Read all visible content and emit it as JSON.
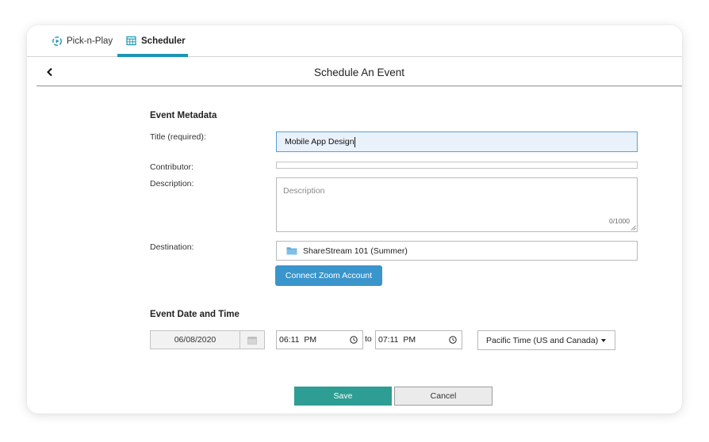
{
  "tabs": [
    {
      "label": "Pick-n-Play",
      "icon": "pick-n-play-icon",
      "active": false
    },
    {
      "label": "Scheduler",
      "icon": "calendar-grid-icon",
      "active": true
    }
  ],
  "header": {
    "title": "Schedule An Event",
    "back_icon": "chevron-left-icon"
  },
  "metadata": {
    "section_title": "Event Metadata",
    "title_label": "Title (required):",
    "title_value": "Mobile App Design",
    "contributor_label": "Contributor:",
    "contributor_value": "",
    "description_label": "Description:",
    "description_placeholder": "Description",
    "description_counter": "0/1000",
    "destination_label": "Destination:",
    "destination_value": "ShareStream 101 (Summer)",
    "destination_icon": "folder-icon",
    "zoom_button": "Connect Zoom Account"
  },
  "datetime": {
    "section_title": "Event Date and Time",
    "date": "06/08/2020",
    "start_time": "06:11  PM",
    "to_label": "to",
    "end_time": "07:11  PM",
    "timezone": "Pacific Time (US and Canada)"
  },
  "actions": {
    "save": "Save",
    "cancel": "Cancel"
  },
  "colors": {
    "tab_accent": "#1a96b4",
    "zoom_button": "#3a95cc",
    "save_button": "#2e9d94",
    "title_focus_bg": "#e9f1fb",
    "title_focus_border": "#5a9fd4"
  }
}
